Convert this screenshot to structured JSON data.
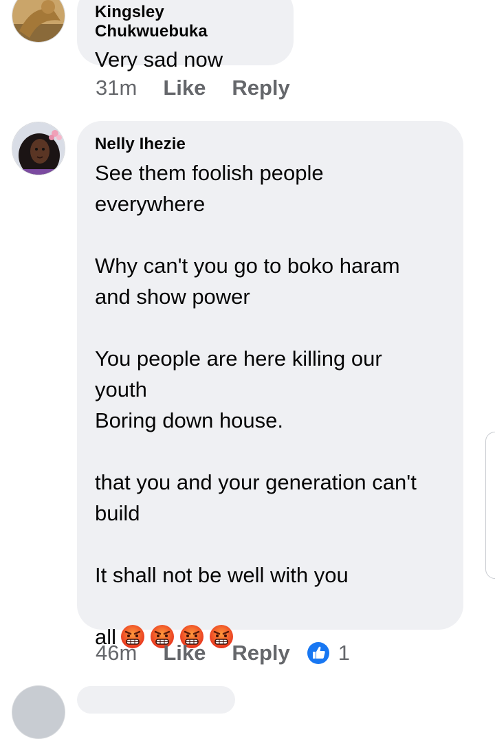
{
  "comments": [
    {
      "author": "Kingsley Chukwuebuka",
      "text": "Very sad now",
      "time": "31m",
      "like_label": "Like",
      "reply_label": "Reply"
    },
    {
      "author": "Nelly Ihezie",
      "text_lines": "See them foolish people\neverywhere\n\nWhy can't you go to boko haram\nand show power\n\nYou people are here killing our\nyouth\nBoring down house.\n\nthat you and your generation can't\nbuild\n\nIt shall not be well with you",
      "text_last": "all",
      "emojis": [
        "angry-face-emoji",
        "angry-face-emoji",
        "angry-face-emoji",
        "angry-face-emoji"
      ],
      "time": "46m",
      "like_label": "Like",
      "reply_label": "Reply",
      "reaction_icon": "like-reaction-icon",
      "reaction_count": "1"
    }
  ],
  "colors": {
    "bubble": "#eff0f3",
    "meta_text": "#65676b",
    "like_blue": "#1877f2"
  }
}
